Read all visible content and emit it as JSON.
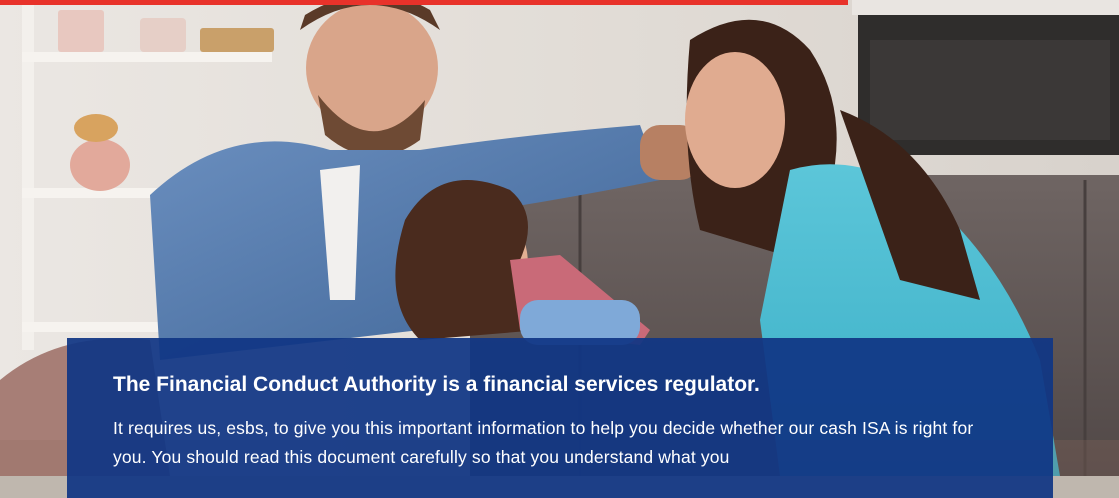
{
  "banner": {
    "accent_color": "#e8322a",
    "photo_description_icon": "family-on-sofa-photo"
  },
  "info_panel": {
    "background_color": "#103684",
    "heading": "The Financial Conduct Authority is a financial services regulator.",
    "body": "It requires us, esbs, to give you this important information to help you decide whether our cash ISA is right for you. You should read this document carefully so that you understand what you"
  }
}
